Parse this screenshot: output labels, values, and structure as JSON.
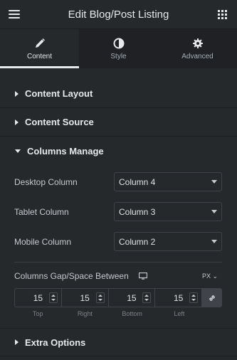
{
  "header": {
    "title": "Edit Blog/Post Listing"
  },
  "tabs": [
    {
      "label": "Content",
      "icon": "pencil-icon"
    },
    {
      "label": "Style",
      "icon": "half-circle-icon"
    },
    {
      "label": "Advanced",
      "icon": "gear-icon"
    }
  ],
  "sections": {
    "content_layout": "Content Layout",
    "content_source": "Content Source",
    "columns_manage": "Columns Manage",
    "extra_options": "Extra Options"
  },
  "columns": {
    "desktop": {
      "label": "Desktop Column",
      "value": "Column 4"
    },
    "tablet": {
      "label": "Tablet Column",
      "value": "Column 3"
    },
    "mobile": {
      "label": "Mobile Column",
      "value": "Column 2"
    }
  },
  "gap": {
    "label": "Columns Gap/Space Between",
    "unit": "PX",
    "top": "15",
    "right": "15",
    "bottom": "15",
    "left": "15",
    "labels": {
      "top": "Top",
      "right": "Right",
      "bottom": "Bottom",
      "left": "Left"
    }
  },
  "colors": {
    "panel": "#26292c",
    "tab_bar": "#1f2124",
    "text": "#e6e8ea",
    "border": "#404349"
  }
}
